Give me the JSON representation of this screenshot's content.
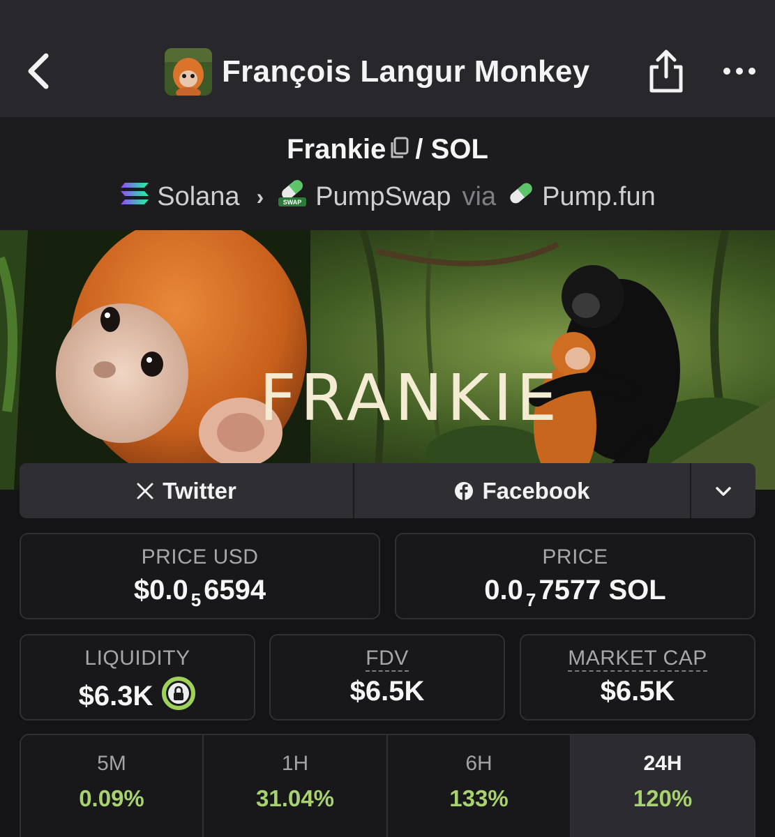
{
  "header": {
    "title": "François Langur Monkey",
    "back_icon": "chevron-left-icon",
    "share_icon": "share-icon",
    "more_icon": "more-horizontal-icon"
  },
  "pair": {
    "base": "Frankie",
    "separator": "/",
    "quote": "SOL",
    "chain": "Solana",
    "dex": "PumpSwap",
    "dex_badge": "SWAP",
    "via": "via",
    "launchpad": "Pump.fun"
  },
  "banner": {
    "text": "FRANKIE"
  },
  "socials": {
    "twitter": "Twitter",
    "facebook": "Facebook"
  },
  "price_usd": {
    "label": "PRICE USD",
    "prefix": "$0.0",
    "zeros": "5",
    "digits": "6594"
  },
  "price_native": {
    "label": "PRICE",
    "prefix": "0.0",
    "zeros": "7",
    "digits": "7577 SOL"
  },
  "liquidity": {
    "label": "LIQUIDITY",
    "value": "$6.3K"
  },
  "fdv": {
    "label": "FDV",
    "value": "$6.5K"
  },
  "market_cap": {
    "label": "MARKET CAP",
    "value": "$6.5K"
  },
  "timeframes": [
    {
      "key": "5M",
      "change": "0.09%"
    },
    {
      "key": "1H",
      "change": "31.04%"
    },
    {
      "key": "6H",
      "change": "133%"
    },
    {
      "key": "24H",
      "change": "120%"
    }
  ],
  "colors": {
    "positive": "#a8d16f",
    "lock_ring": "#9ed15a",
    "background": "#141416"
  }
}
